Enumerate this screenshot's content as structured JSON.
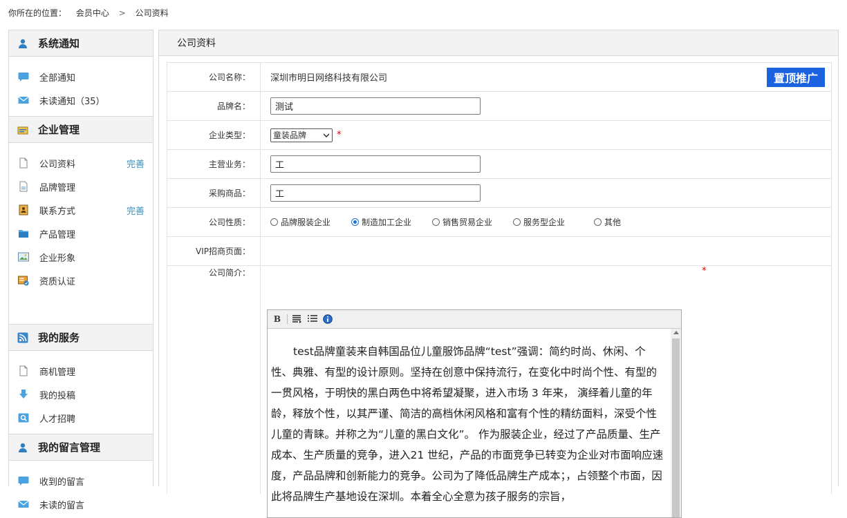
{
  "breadcrumb": {
    "prefix": "你所在的位置：",
    "items": [
      "会员中心",
      "公司资料"
    ],
    "separator": ">"
  },
  "sidebar": {
    "sections": [
      {
        "title": "系统通知",
        "icon": "person-icon",
        "items": [
          {
            "label": "全部通知",
            "badge": "",
            "icon": "chat-bubble-icon"
          },
          {
            "label": "未读通知（35）",
            "badge": "",
            "icon": "envelope-icon"
          }
        ]
      },
      {
        "title": "企业管理",
        "icon": "briefcase-icon",
        "items": [
          {
            "label": "公司资料",
            "badge": "完善",
            "icon": "document-icon"
          },
          {
            "label": "品牌管理",
            "badge": "",
            "icon": "document-lines-icon"
          },
          {
            "label": "联系方式",
            "badge": "完善",
            "icon": "contact-card-icon"
          },
          {
            "label": "产品管理",
            "badge": "",
            "icon": "folder-icon"
          },
          {
            "label": "企业形象",
            "badge": "",
            "icon": "picture-icon"
          },
          {
            "label": "资质认证",
            "badge": "",
            "icon": "certificate-icon"
          }
        ]
      },
      {
        "title": "我的服务",
        "icon": "rss-icon",
        "items": [
          {
            "label": "商机管理",
            "badge": "",
            "icon": "document-icon"
          },
          {
            "label": "我的投稿",
            "badge": "",
            "icon": "download-arrow-icon"
          },
          {
            "label": "人才招聘",
            "badge": "",
            "icon": "search-card-icon"
          }
        ]
      },
      {
        "title": "我的留言管理",
        "icon": "person-icon",
        "items": [
          {
            "label": "收到的留言",
            "badge": "",
            "icon": "chat-bubble-icon"
          },
          {
            "label": "未读的留言",
            "badge": "",
            "icon": "envelope-icon"
          }
        ]
      }
    ]
  },
  "main": {
    "title": "公司资料",
    "promote_label": "置顶推广",
    "form": {
      "company_name_label": "公司名称：",
      "company_name_value": "深圳市明日网络科技有限公司",
      "brand_label": "品牌名：",
      "brand_value": "测试",
      "type_label": "企业类型：",
      "type_value": "童装品牌",
      "required_mark": "*",
      "business_label": "主营业务：",
      "business_value": "工",
      "purchase_label": "采购商品：",
      "purchase_value": "工",
      "nature_label": "公司性质：",
      "nature_options": [
        "品牌服装企业",
        "制造加工企业",
        "销售贸易企业",
        "服务型企业",
        "其他"
      ],
      "nature_selected": "制造加工企业",
      "vip_label": "VIP招商页面：",
      "intro_label": "公司简介：",
      "intro_text": "test品牌童装来自韩国品位儿童服饰品牌“test”强调：简约时尚、休闲、个性、典雅、有型的设计原则。坚持在创意中保持流行，在变化中时尚个性、有型的一贯风格，于明快的黑白两色中将希望凝聚，进入市场 3 年来， 演绎着儿童的年龄，释放个性，以其严谨、简洁的高档休闲风格和富有个性的精纺面料，深受个性儿童的青睐。并称之为“儿童的黑白文化”。 作为服装企业，经过了产品质量、生产成本、生产质量的竞争，进入21 世纪，产品的市面竞争已转变为企业对市面响应速度，产品品牌和创新能力的竞争。公司为了降低品牌生产成本；，占领整个市面，因此将品牌生产基地设在深圳。本着全心全意为孩子服务的宗旨，"
    },
    "toolbar": {
      "bold_label": "B"
    }
  },
  "colors": {
    "accent_blue": "#1a62e0",
    "badge_blue": "#3d8fbd",
    "required_red": "#dd0000"
  }
}
